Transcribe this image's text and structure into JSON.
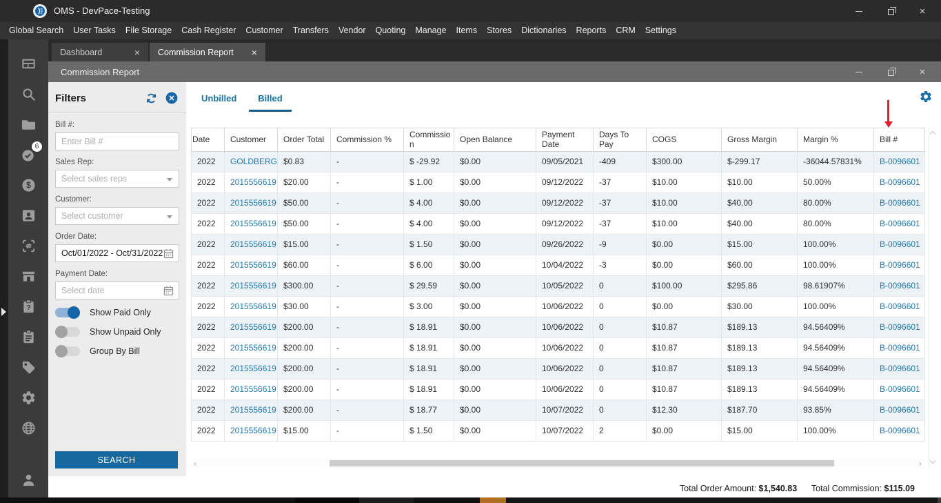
{
  "titlebar": {
    "title": "OMS - DevPace-Testing"
  },
  "menubar": {
    "items": [
      "Global Search",
      "User Tasks",
      "File Storage",
      "Cash Register",
      "Customer",
      "Transfers",
      "Vendor",
      "Quoting",
      "Manage",
      "Items",
      "Stores",
      "Dictionaries",
      "Reports",
      "CRM",
      "Settings"
    ]
  },
  "sidebar": {
    "task_badge": "6",
    "icons": [
      "dashboard-icon",
      "search-icon",
      "file-storage-icon",
      "tasks-check-icon",
      "cash-register-icon",
      "customer-icon",
      "transfers-icon",
      "store-icon",
      "quoting-icon",
      "manage-clipboard-icon",
      "items-tag-icon",
      "settings-gear-icon",
      "globe-icon",
      "user-profile-icon"
    ]
  },
  "tabs": {
    "items": [
      {
        "label": "Dashboard",
        "active": false
      },
      {
        "label": "Commission Report",
        "active": true
      }
    ]
  },
  "inner_window": {
    "title": "Commission Report"
  },
  "filters": {
    "title": "Filters",
    "fields": {
      "bill": {
        "label": "Bill #:",
        "placeholder": "Enter Bill #"
      },
      "sales_rep": {
        "label": "Sales Rep:",
        "placeholder": "Select sales reps"
      },
      "customer": {
        "label": "Customer:",
        "placeholder": "Select customer"
      },
      "order_date": {
        "label": "Order Date:",
        "value": "Oct/01/2022 - Oct/31/2022"
      },
      "payment_date": {
        "label": "Payment Date:",
        "placeholder": "Select date"
      }
    },
    "toggles": [
      {
        "label": "Show Paid Only",
        "on": true
      },
      {
        "label": "Show Unpaid Only",
        "on": false
      },
      {
        "label": "Group By Bill",
        "on": false
      }
    ],
    "search_button": "SEARCH"
  },
  "report": {
    "tabs": [
      {
        "label": "Unbilled",
        "active": false
      },
      {
        "label": "Billed",
        "active": true
      }
    ],
    "table": {
      "columns": [
        "Date",
        "Customer",
        "Order Total",
        "Commission %",
        "Commission",
        "Open Balance",
        "Payment Date",
        "Days To Pay",
        "COGS",
        "Gross Margin",
        "Margin %",
        "Bill #"
      ],
      "link_columns": [
        1,
        11
      ],
      "rows": [
        [
          "2022",
          "GOLDBERG",
          "$0.83",
          "-",
          "$ -29.92",
          "$0.00",
          "09/05/2021",
          "-409",
          "$300.00",
          "$-299.17",
          "-36044.57831%",
          "B-0096601"
        ],
        [
          "2022",
          "2015556619",
          "$20.00",
          "-",
          "$ 1.00",
          "$0.00",
          "09/12/2022",
          "-37",
          "$10.00",
          "$10.00",
          "50.00%",
          "B-0096601"
        ],
        [
          "2022",
          "2015556619",
          "$50.00",
          "-",
          "$ 4.00",
          "$0.00",
          "09/12/2022",
          "-37",
          "$10.00",
          "$40.00",
          "80.00%",
          "B-0096601"
        ],
        [
          "2022",
          "2015556619",
          "$50.00",
          "-",
          "$ 4.00",
          "$0.00",
          "09/12/2022",
          "-37",
          "$10.00",
          "$40.00",
          "80.00%",
          "B-0096601"
        ],
        [
          "2022",
          "2015556619",
          "$15.00",
          "-",
          "$ 1.50",
          "$0.00",
          "09/26/2022",
          "-9",
          "$0.00",
          "$15.00",
          "100.00%",
          "B-0096601"
        ],
        [
          "2022",
          "2015556619",
          "$60.00",
          "-",
          "$ 6.00",
          "$0.00",
          "10/04/2022",
          "-3",
          "$0.00",
          "$60.00",
          "100.00%",
          "B-0096601"
        ],
        [
          "2022",
          "2015556619",
          "$300.00",
          "-",
          "$ 29.59",
          "$0.00",
          "10/05/2022",
          "0",
          "$100.00",
          "$295.86",
          "98.61907%",
          "B-0096601"
        ],
        [
          "2022",
          "2015556619",
          "$30.00",
          "-",
          "$ 3.00",
          "$0.00",
          "10/06/2022",
          "0",
          "$0.00",
          "$30.00",
          "100.00%",
          "B-0096601"
        ],
        [
          "2022",
          "2015556619",
          "$200.00",
          "-",
          "$ 18.91",
          "$0.00",
          "10/06/2022",
          "0",
          "$10.87",
          "$189.13",
          "94.56409%",
          "B-0096601"
        ],
        [
          "2022",
          "2015556619",
          "$200.00",
          "-",
          "$ 18.91",
          "$0.00",
          "10/06/2022",
          "0",
          "$10.87",
          "$189.13",
          "94.56409%",
          "B-0096601"
        ],
        [
          "2022",
          "2015556619",
          "$200.00",
          "-",
          "$ 18.91",
          "$0.00",
          "10/06/2022",
          "0",
          "$10.87",
          "$189.13",
          "94.56409%",
          "B-0096601"
        ],
        [
          "2022",
          "2015556619",
          "$200.00",
          "-",
          "$ 18.91",
          "$0.00",
          "10/06/2022",
          "0",
          "$10.87",
          "$189.13",
          "94.56409%",
          "B-0096601"
        ],
        [
          "2022",
          "2015556619",
          "$200.00",
          "-",
          "$ 18.77",
          "$0.00",
          "10/07/2022",
          "0",
          "$12.30",
          "$187.70",
          "93.85%",
          "B-0096601"
        ],
        [
          "2022",
          "2015556619",
          "$15.00",
          "-",
          "$ 1.50",
          "$0.00",
          "10/07/2022",
          "2",
          "$0.00",
          "$15.00",
          "100.00%",
          "B-0096601"
        ]
      ]
    },
    "totals": {
      "order_label": "Total Order Amount:",
      "order_value": "$1,540.83",
      "commission_label": "Total Commission:",
      "commission_value": "$115.09"
    }
  },
  "colors": {
    "accent_blue": "#1673ab",
    "link_blue": "#1d7ab3",
    "button_blue": "#17689f",
    "toggle_on_blue": "#1565a8",
    "annotation_red": "#e11d2e",
    "row_stripe": "#eef3f8"
  }
}
